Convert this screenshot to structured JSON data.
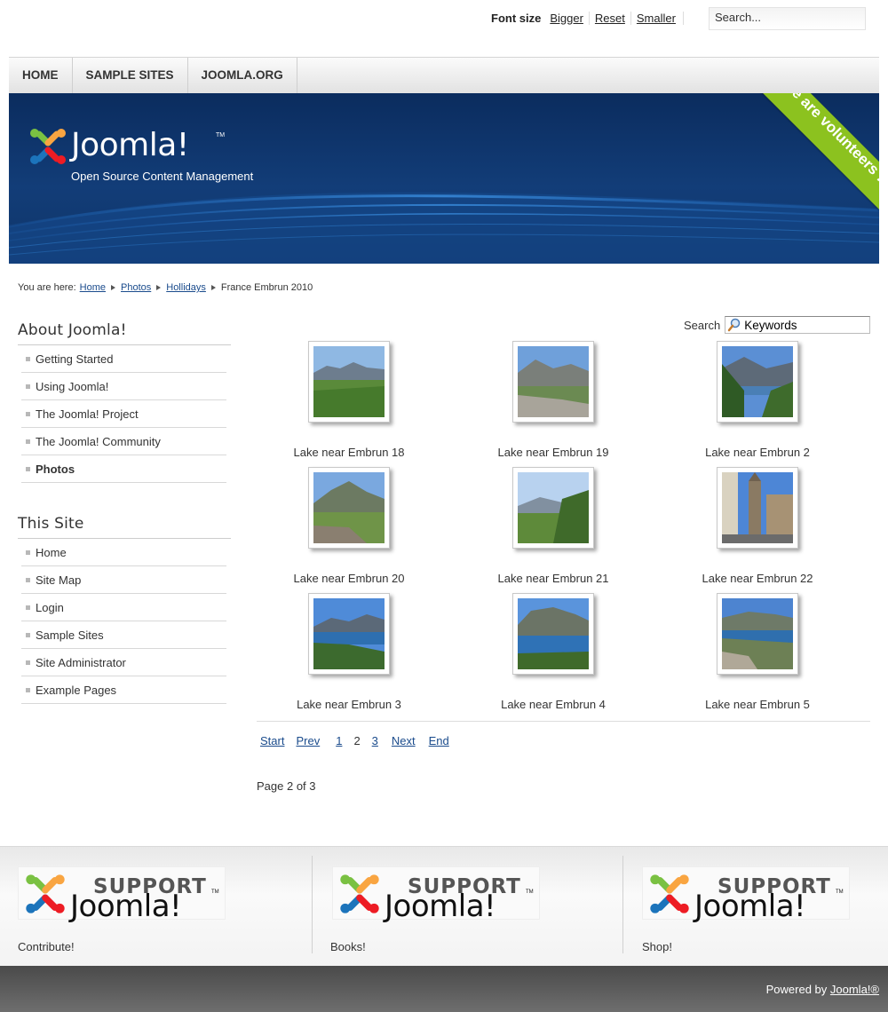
{
  "top": {
    "font_size_label": "Font size",
    "bigger": "Bigger",
    "reset": "Reset",
    "smaller": "Smaller",
    "search_value": "Search..."
  },
  "nav": [
    "HOME",
    "SAMPLE SITES",
    "JOOMLA.ORG"
  ],
  "header": {
    "logo_text": "Joomla!",
    "logo_tm": "TM",
    "tagline": "Open Source Content Management",
    "ribbon": "We are volunteers !"
  },
  "breadcrumb": {
    "label": "You are here:",
    "links": [
      "Home",
      "Photos",
      "Hollidays"
    ],
    "current": "France Embrun 2010"
  },
  "sidebar": {
    "about_title": "About Joomla!",
    "about_items": [
      "Getting Started",
      "Using Joomla!",
      "The Joomla! Project",
      "The Joomla! Community",
      "Photos"
    ],
    "site_title": "This Site",
    "site_items": [
      "Home",
      "Site Map",
      "Login",
      "Sample Sites",
      "Site Administrator",
      "Example Pages"
    ]
  },
  "gallery": {
    "search_label": "Search",
    "search_value": "Keywords",
    "items": [
      "Lake near Embrun 18",
      "Lake near Embrun 19",
      "Lake near Embrun 2",
      "Lake near Embrun 20",
      "Lake near Embrun 21",
      "Lake near Embrun 22",
      "Lake near Embrun 3",
      "Lake near Embrun 4",
      "Lake near Embrun 5"
    ],
    "pager": {
      "start": "Start",
      "prev": "Prev",
      "p1": "1",
      "p2": "2",
      "p3": "3",
      "next": "Next",
      "end": "End"
    },
    "page_count": "Page 2 of 3"
  },
  "footer": {
    "support_word": "SUPPORT",
    "joomla_word": "Joomla!",
    "tm": "TM",
    "labels": [
      "Contribute!",
      "Books!",
      "Shop!"
    ]
  },
  "bottom": {
    "powered_prefix": "Powered by ",
    "powered_link": "Joomla!®"
  },
  "colors": {
    "header_blue": "#0b2c5e",
    "ribbon_green": "#8cc21f",
    "link_blue": "#1a4b8c",
    "bottom_bar": "#4a4a4a"
  }
}
